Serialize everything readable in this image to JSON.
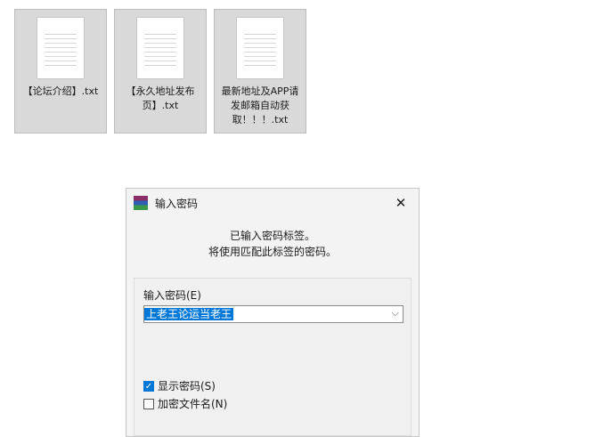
{
  "files": [
    {
      "name": "【论坛介绍】.txt"
    },
    {
      "name": "【永久地址发布页】.txt"
    },
    {
      "name": "最新地址及APP请发邮箱自动获取！！！.txt"
    }
  ],
  "dialog": {
    "title": "输入密码",
    "info_line1": "已输入密码标签。",
    "info_line2": "将使用匹配此标签的密码。",
    "field_label": "输入密码(E)",
    "password_value": "上老王论运当老王",
    "show_password_label": "显示密码(S)",
    "show_password_checked": true,
    "encrypt_names_label": "加密文件名(N)",
    "encrypt_names_checked": false
  }
}
